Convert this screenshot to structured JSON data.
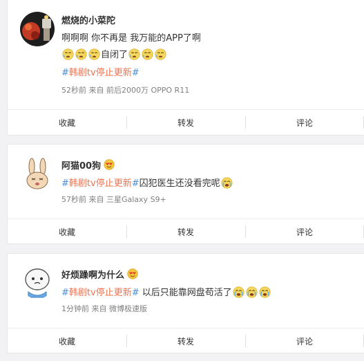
{
  "posts": [
    {
      "username": "燃烧的小菜陀",
      "text1": "啊啊啊 你不再是 我万能的APP了啊",
      "emoji_label": "自闭了",
      "hashtag": "韩剧tv停止更新",
      "meta": "52秒前 来自 前后2000万 OPPO R11",
      "actions": {
        "favorite": "收藏",
        "repost": "转发",
        "comment": "评论"
      }
    },
    {
      "username": "阿猫00狗",
      "hashtag": "韩剧tv停止更新",
      "text": "囚犯医生还没看完呢",
      "meta": "57秒前 来自 三星Galaxy S9+",
      "actions": {
        "favorite": "收藏",
        "repost": "转发",
        "comment": "评论"
      }
    },
    {
      "username": "好烦躁啊为什么",
      "hashtag": "韩剧tv停止更新",
      "text": " 以后只能靠网盘苟活了",
      "meta": "1分钟前 来自 微博极速版",
      "actions": {
        "favorite": "收藏",
        "repost": "转发",
        "comment": "评论"
      }
    }
  ],
  "hash_symbol": "#",
  "colors": {
    "hashtag": "#eb7350",
    "hash": "#4a90d9",
    "meta": "#808080"
  },
  "icons": [
    "avatar-photo",
    "cry-face-icon",
    "heart-eyes-badge-icon",
    "sob-face-icon"
  ]
}
